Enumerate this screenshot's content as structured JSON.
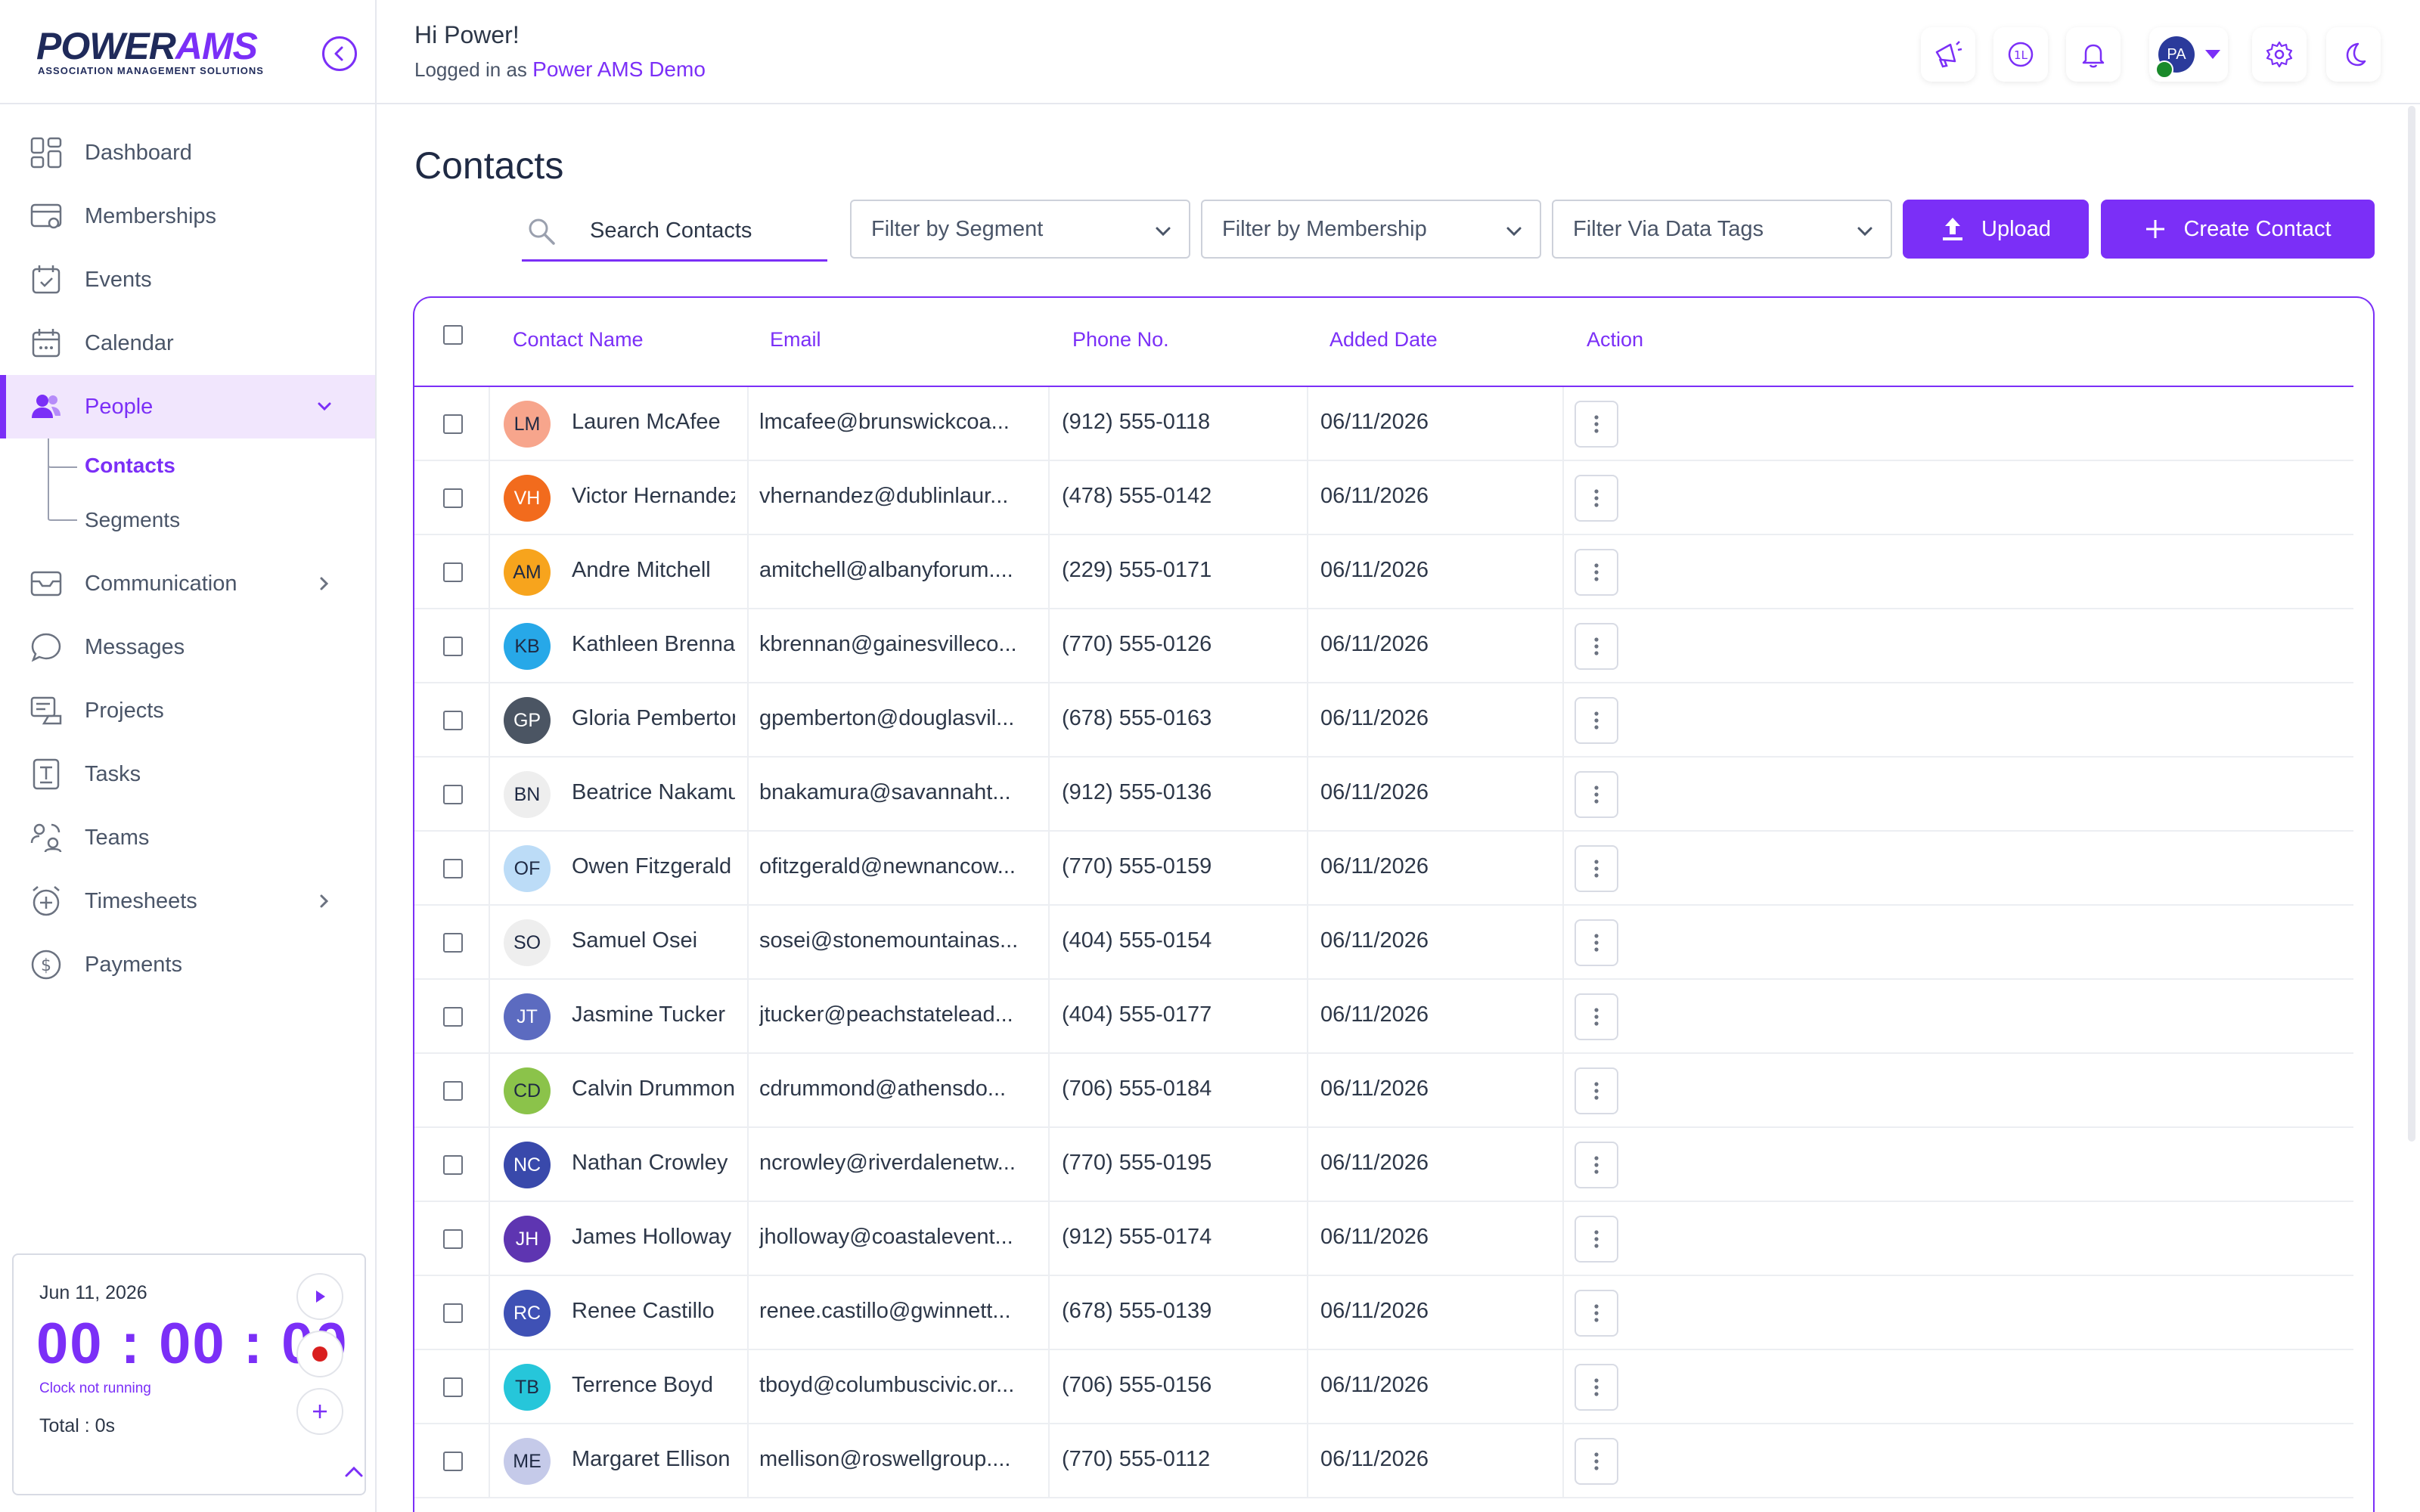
{
  "brand": {
    "logo_power": "POWER",
    "logo_ams": "AMS",
    "logo_sub": "ASSOCIATION MANAGEMENT SOLUTIONS",
    "accent": "#7b2ff7"
  },
  "header": {
    "greeting": "Hi Power!",
    "logged_in_prefix": "Logged in as",
    "org_name": "Power AMS Demo",
    "avatar_initials": "PA",
    "icons": [
      "megaphone-icon",
      "refresh-badge-icon",
      "bell-icon",
      "gear-icon",
      "moon-icon"
    ]
  },
  "sidebar": {
    "items": [
      {
        "label": "Dashboard",
        "icon": "dashboard-icon"
      },
      {
        "label": "Memberships",
        "icon": "memberships-icon"
      },
      {
        "label": "Events",
        "icon": "events-icon"
      },
      {
        "label": "Calendar",
        "icon": "calendar-icon"
      },
      {
        "label": "People",
        "icon": "people-icon",
        "active": true,
        "expanded": true
      },
      {
        "label": "Communication",
        "icon": "communication-icon",
        "has_children": true
      },
      {
        "label": "Messages",
        "icon": "messages-icon"
      },
      {
        "label": "Projects",
        "icon": "projects-icon"
      },
      {
        "label": "Tasks",
        "icon": "tasks-icon"
      },
      {
        "label": "Teams",
        "icon": "teams-icon"
      },
      {
        "label": "Timesheets",
        "icon": "timesheets-icon",
        "has_children": true
      },
      {
        "label": "Payments",
        "icon": "payments-icon"
      }
    ],
    "people_sub": [
      {
        "label": "Contacts",
        "active": true
      },
      {
        "label": "Segments"
      }
    ]
  },
  "timer": {
    "date": "Jun 11, 2026",
    "clock": "00 : 00 : 00",
    "status": "Clock not running",
    "total": "Total : 0s"
  },
  "main": {
    "title": "Contacts",
    "search_placeholder": "Search Contacts",
    "filters": [
      "Filter by Segment",
      "Filter by Membership",
      "Filter Via Data Tags"
    ],
    "upload_label": "Upload",
    "create_label": "Create Contact",
    "columns": [
      "Contact Name",
      "Email",
      "Phone No.",
      "Added Date",
      "Action"
    ],
    "rows": [
      {
        "initials": "LM",
        "color": "#f7a58c",
        "name": "Lauren McAfee",
        "email": "lmcafee@brunswickcoa...",
        "phone": "(912) 555-0118",
        "date": "06/11/2026"
      },
      {
        "initials": "VH",
        "color": "#f26b1d",
        "name": "Victor Hernandez",
        "email": "vhernandez@dublinlaur...",
        "phone": "(478) 555-0142",
        "date": "06/11/2026"
      },
      {
        "initials": "AM",
        "color": "#f7a41d",
        "name": "Andre Mitchell",
        "email": "amitchell@albanyforum....",
        "phone": "(229) 555-0171",
        "date": "06/11/2026"
      },
      {
        "initials": "KB",
        "color": "#27a8e8",
        "name": "Kathleen Brennan",
        "email": "kbrennan@gainesvilleco...",
        "phone": "(770) 555-0126",
        "date": "06/11/2026"
      },
      {
        "initials": "GP",
        "color": "#4b5563",
        "name": "Gloria Pemberton",
        "email": "gpemberton@douglasvil...",
        "phone": "(678) 555-0163",
        "date": "06/11/2026"
      },
      {
        "initials": "BN",
        "color": "#eeeeee",
        "name": "Beatrice Nakamura",
        "email": "bnakamura@savannaht...",
        "phone": "(912) 555-0136",
        "date": "06/11/2026"
      },
      {
        "initials": "OF",
        "color": "#bcdcf7",
        "name": "Owen Fitzgerald",
        "email": "ofitzgerald@newnancow...",
        "phone": "(770) 555-0159",
        "date": "06/11/2026"
      },
      {
        "initials": "SO",
        "color": "#eeeeee",
        "name": "Samuel Osei",
        "email": "sosei@stonemountainas...",
        "phone": "(404) 555-0154",
        "date": "06/11/2026"
      },
      {
        "initials": "JT",
        "color": "#5c6bc0",
        "name": "Jasmine Tucker",
        "email": "jtucker@peachstatelead...",
        "phone": "(404) 555-0177",
        "date": "06/11/2026"
      },
      {
        "initials": "CD",
        "color": "#8bc34a",
        "name": "Calvin Drummond",
        "email": "cdrummond@athensdo...",
        "phone": "(706) 555-0184",
        "date": "06/11/2026"
      },
      {
        "initials": "NC",
        "color": "#3949ab",
        "name": "Nathan Crowley",
        "email": "ncrowley@riverdalenetw...",
        "phone": "(770) 555-0195",
        "date": "06/11/2026"
      },
      {
        "initials": "JH",
        "color": "#5e35b1",
        "name": "James Holloway",
        "email": "jholloway@coastalevent...",
        "phone": "(912) 555-0174",
        "date": "06/11/2026"
      },
      {
        "initials": "RC",
        "color": "#3f51b5",
        "name": "Renee Castillo",
        "email": "renee.castillo@gwinnett...",
        "phone": "(678) 555-0139",
        "date": "06/11/2026"
      },
      {
        "initials": "TB",
        "color": "#26c6da",
        "name": "Terrence Boyd",
        "email": "tboyd@columbuscivic.or...",
        "phone": "(706) 555-0156",
        "date": "06/11/2026"
      },
      {
        "initials": "ME",
        "color": "#c5cae9",
        "name": "Margaret Ellison",
        "email": "mellison@roswellgroup....",
        "phone": "(770) 555-0112",
        "date": "06/11/2026"
      }
    ]
  }
}
